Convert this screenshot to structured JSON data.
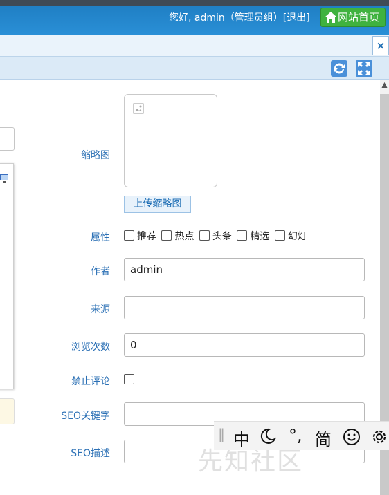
{
  "header": {
    "greeting": "您好, admin（管理员组）[退出]",
    "home_button": "网站首页"
  },
  "tabs": {
    "close_label": "×"
  },
  "form": {
    "thumbnail_label": "缩略图",
    "upload_button": "上传缩略图",
    "attributes_label": "属性",
    "attributes": [
      "推荐",
      "热点",
      "头条",
      "精选",
      "幻灯"
    ],
    "author_label": "作者",
    "author_value": "admin",
    "source_label": "来源",
    "source_value": "",
    "views_label": "浏览次数",
    "views_value": "0",
    "disable_comment_label": "禁止评论",
    "seo_keywords_label": "SEO关键字",
    "seo_keywords_value": "",
    "seo_description_label": "SEO描述",
    "seo_description_value": ""
  },
  "ime_bar": {
    "mode": "中",
    "punct": "°,",
    "script": "简"
  },
  "watermark": "先知社区",
  "colors": {
    "header_blue": "#2a8fd6",
    "label_blue": "#2b70b5",
    "home_green": "#3fb23f"
  }
}
